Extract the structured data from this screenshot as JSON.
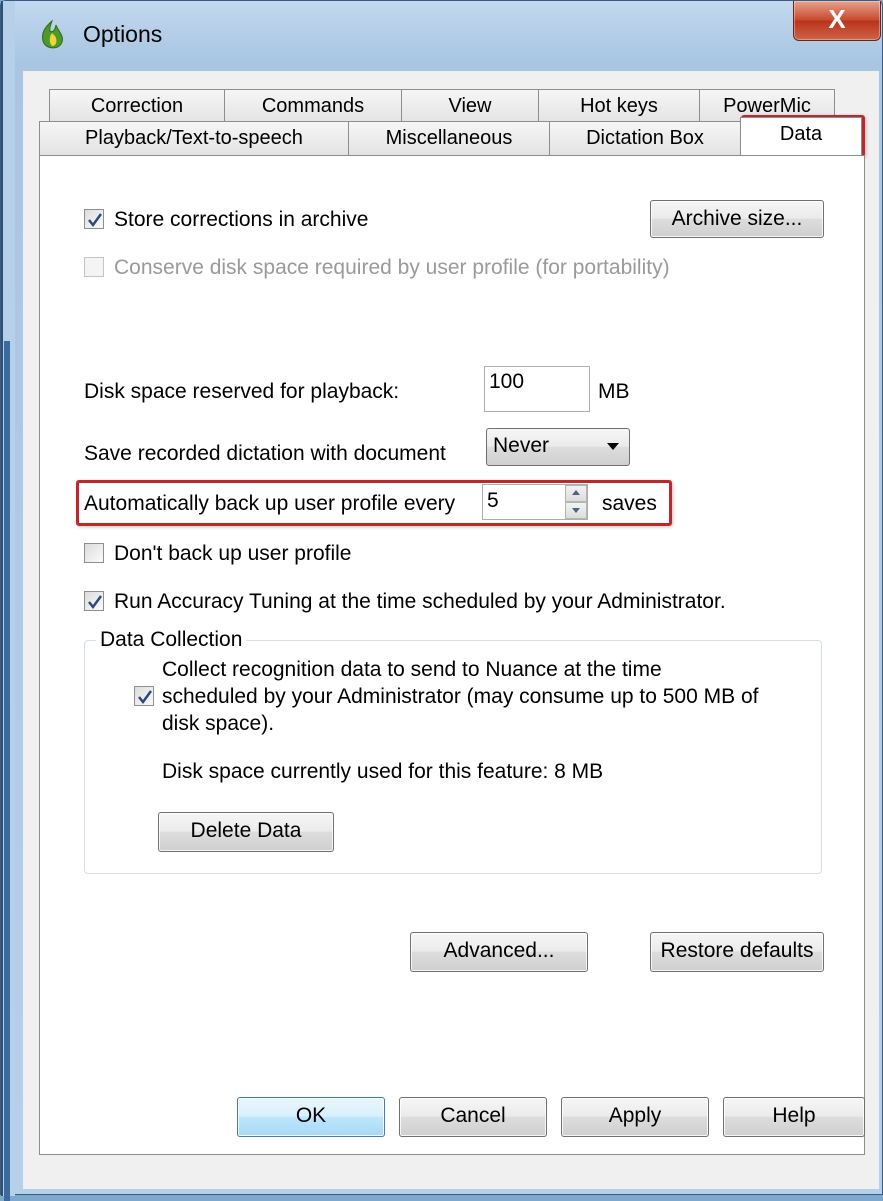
{
  "window": {
    "title": "Options",
    "close_glyph": "X",
    "app_icon": "dragon-flame-icon"
  },
  "tabs": {
    "row_back": [
      "Correction",
      "Commands",
      "View",
      "Hot keys",
      "PowerMic"
    ],
    "row_front": [
      "Playback/Text-to-speech",
      "Miscellaneous",
      "Dictation Box",
      "Data"
    ],
    "selected": "Data"
  },
  "data_tab": {
    "store_corrections": {
      "label": "Store corrections in archive",
      "checked": true
    },
    "archive_size_button": "Archive size...",
    "conserve_disk": {
      "label": "Conserve disk space required by user profile (for portability)",
      "checked": false,
      "enabled": false
    },
    "playback_space": {
      "label": "Disk space reserved for playback:",
      "value": "100",
      "unit": "MB"
    },
    "save_dictation": {
      "label": "Save recorded dictation with document",
      "value": "Never"
    },
    "auto_backup": {
      "label": "Automatically back up user profile every",
      "value": "5",
      "unit": "saves"
    },
    "dont_backup": {
      "label": "Don't back up user profile",
      "checked": false
    },
    "accuracy_tuning": {
      "label": "Run Accuracy Tuning at the time scheduled by your Administrator.",
      "checked": true
    },
    "data_collection": {
      "title": "Data Collection",
      "collect_line1": "Collect recognition data to send to Nuance at the time",
      "collect_line2": "scheduled by your Administrator (may consume up to 500 MB of",
      "collect_line3": "disk space).",
      "checked": true,
      "disk_usage": "Disk space currently used for this feature: 8 MB",
      "delete_button": "Delete Data"
    },
    "advanced_button": "Advanced...",
    "restore_button": "Restore defaults"
  },
  "footer": {
    "ok": "OK",
    "cancel": "Cancel",
    "apply": "Apply",
    "help": "Help"
  },
  "colors": {
    "highlight": "#c0272d",
    "panel": "#ffffff",
    "dialog": "#f0f0f0",
    "title_bar": "#a8c5e2"
  }
}
